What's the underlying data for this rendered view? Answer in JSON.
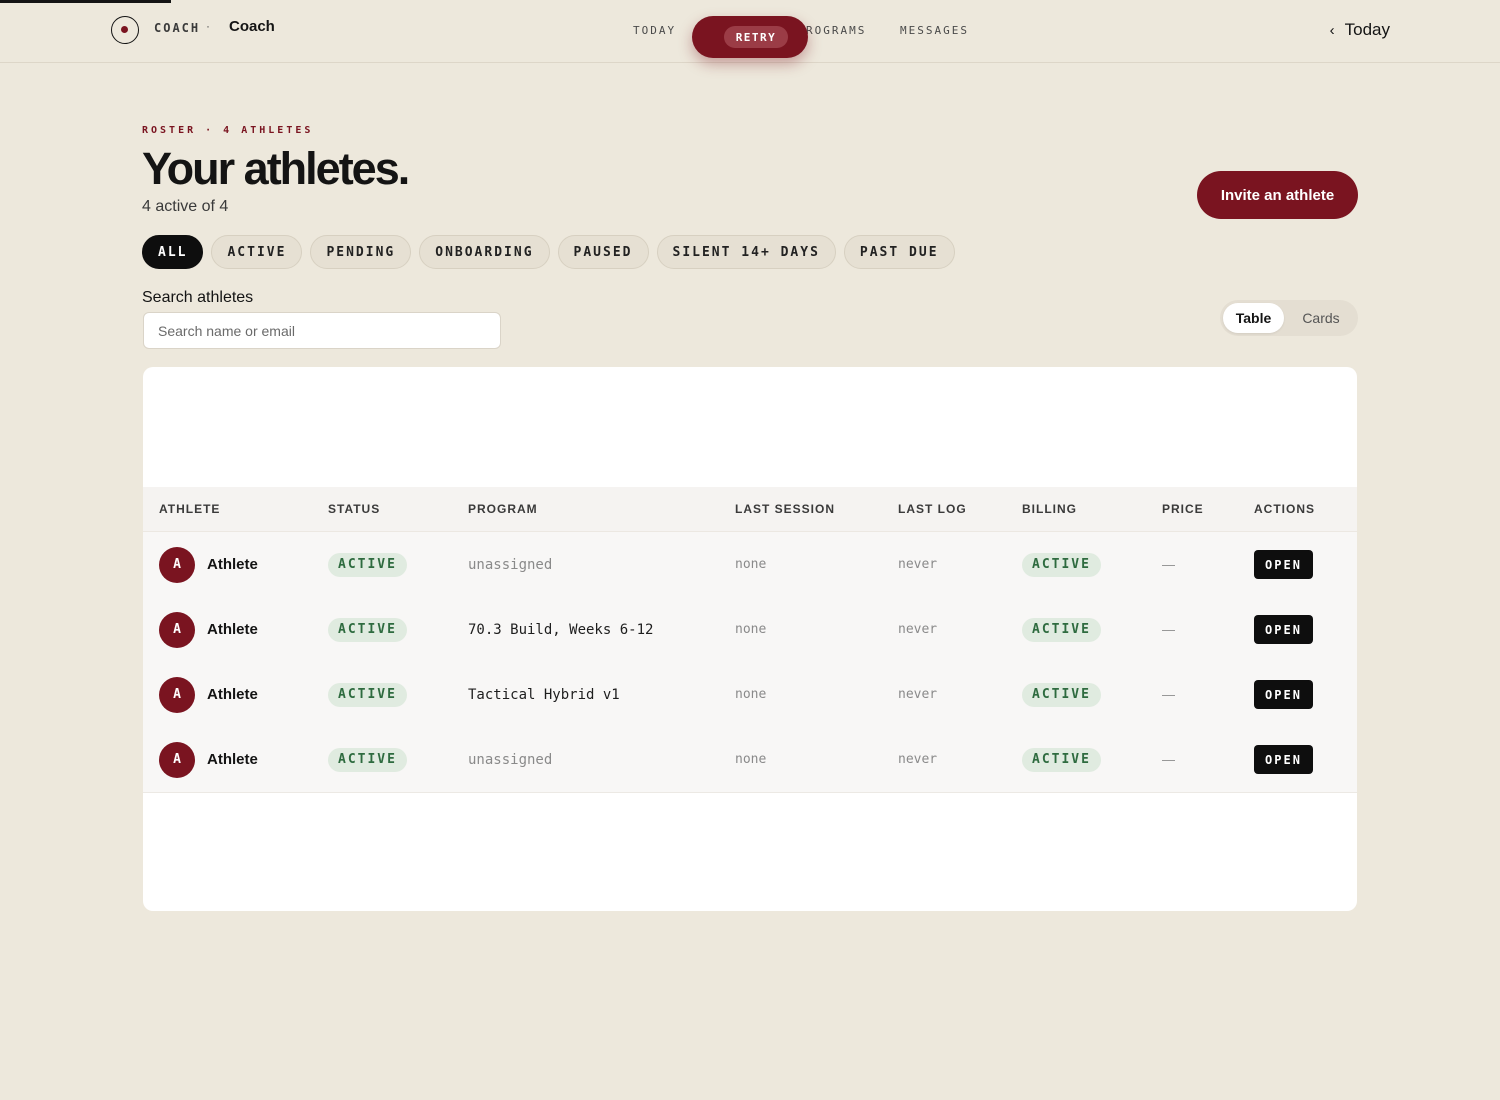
{
  "header": {
    "brand_kicker": "COACH",
    "brand_separator": "·",
    "brand_name": "Coach",
    "nav": [
      {
        "label": "TODAY"
      },
      {
        "label": "ROGRAMS"
      },
      {
        "label": "MESSAGES"
      }
    ],
    "retry_label": "RETRY",
    "back_link": "Today"
  },
  "page": {
    "eyebrow": "ROSTER · 4 ATHLETES",
    "title": "Your athletes.",
    "subtitle": "4 active of 4",
    "invite_label": "Invite an athlete"
  },
  "filters": [
    {
      "label": "ALL",
      "selected": true
    },
    {
      "label": "ACTIVE"
    },
    {
      "label": "PENDING"
    },
    {
      "label": "ONBOARDING"
    },
    {
      "label": "PAUSED"
    },
    {
      "label": "SILENT 14+ DAYS"
    },
    {
      "label": "PAST DUE"
    }
  ],
  "search": {
    "label": "Search athletes",
    "placeholder": "Search name or email",
    "value": ""
  },
  "view_toggle": {
    "options": [
      "Table",
      "Cards"
    ],
    "selected": "Table"
  },
  "table": {
    "columns": [
      "ATHLETE",
      "STATUS",
      "PROGRAM",
      "LAST SESSION",
      "LAST LOG",
      "BILLING",
      "PRICE",
      "ACTIONS"
    ],
    "rows": [
      {
        "initial": "A",
        "name": "Athlete",
        "status": "ACTIVE",
        "program": "unassigned",
        "last_session": "none",
        "last_log": "never",
        "billing": "ACTIVE",
        "price": "—",
        "action": "OPEN"
      },
      {
        "initial": "A",
        "name": "Athlete",
        "status": "ACTIVE",
        "program": "70.3 Build, Weeks 6-12",
        "last_session": "none",
        "last_log": "never",
        "billing": "ACTIVE",
        "price": "—",
        "action": "OPEN"
      },
      {
        "initial": "A",
        "name": "Athlete",
        "status": "ACTIVE",
        "program": "Tactical Hybrid v1",
        "last_session": "none",
        "last_log": "never",
        "billing": "ACTIVE",
        "price": "—",
        "action": "OPEN"
      },
      {
        "initial": "A",
        "name": "Athlete",
        "status": "ACTIVE",
        "program": "unassigned",
        "last_session": "none",
        "last_log": "never",
        "billing": "ACTIVE",
        "price": "—",
        "action": "OPEN"
      }
    ]
  },
  "colors": {
    "accent": "#7a1420",
    "background": "#ede8dc",
    "status_green": "#2e6b3f",
    "status_green_bg": "#e0ebe0"
  },
  "icons": [
    "logo-icon",
    "chevron-left-icon"
  ]
}
